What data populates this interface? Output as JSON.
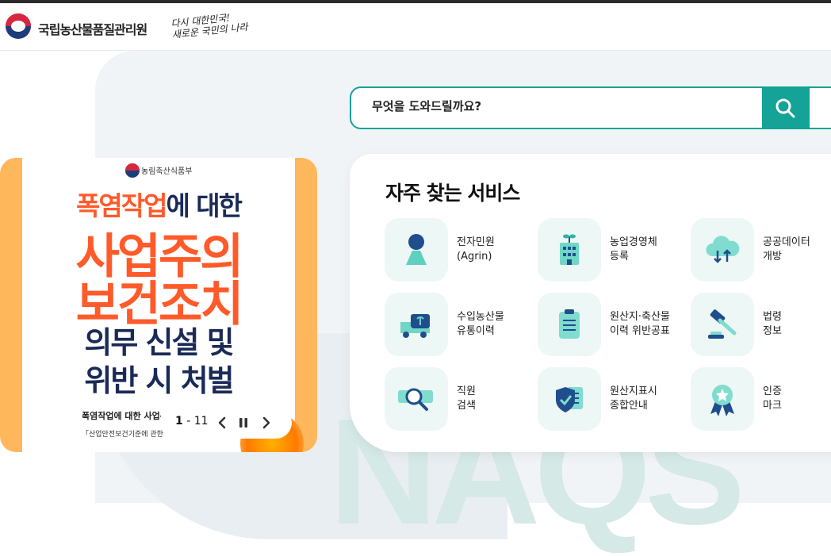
{
  "header": {
    "org_name": "국립농산물품질관리원",
    "slogan_line1": "다시 대한민국!",
    "slogan_line2": "새로운 국민의 나라"
  },
  "search": {
    "placeholder": "무엇을 도와드릴까요?",
    "button_icon": "search-icon"
  },
  "banner": {
    "ministry": "농림축산식품부",
    "line1_accent": "폭염작업",
    "line1_rest": "에 대한",
    "line2": "사업주의",
    "line3": "보건조치",
    "line4": "의무 신설 및",
    "line5": "위반 시 처벌",
    "caption": "폭염작업에 대한 사업주",
    "subcaption": "「산업안전보건기준에 관한",
    "current_page": "1",
    "page_separator": "-",
    "total_pages": "11",
    "icons": [
      "chevron-left-icon",
      "pause-icon",
      "chevron-right-icon"
    ]
  },
  "services": {
    "title": "자주 찾는 서비스",
    "items": [
      {
        "label": "전자민원\n(Agrin)",
        "icon": "person-icon"
      },
      {
        "label": "농업경영체\n등록",
        "icon": "building-sprout-icon"
      },
      {
        "label": "공공데이터\n개방",
        "icon": "cloud-transfer-icon"
      },
      {
        "label": "수입농산물\n유통이력",
        "icon": "truck-sprout-icon"
      },
      {
        "label": "원산지·축산물\n이력 위반공표",
        "icon": "clipboard-icon"
      },
      {
        "label": "법령\n정보",
        "icon": "gavel-icon"
      },
      {
        "label": "직원\n검색",
        "icon": "magnifier-card-icon"
      },
      {
        "label": "원산지표시\n종합안내",
        "icon": "shield-document-icon"
      },
      {
        "label": "인증\n마크",
        "icon": "badge-ribbon-icon"
      }
    ]
  },
  "colors": {
    "accent": "#14a396",
    "banner_orange": "#ffb75c",
    "poster_red": "#ff5a2a",
    "poster_navy": "#1b2b57"
  }
}
